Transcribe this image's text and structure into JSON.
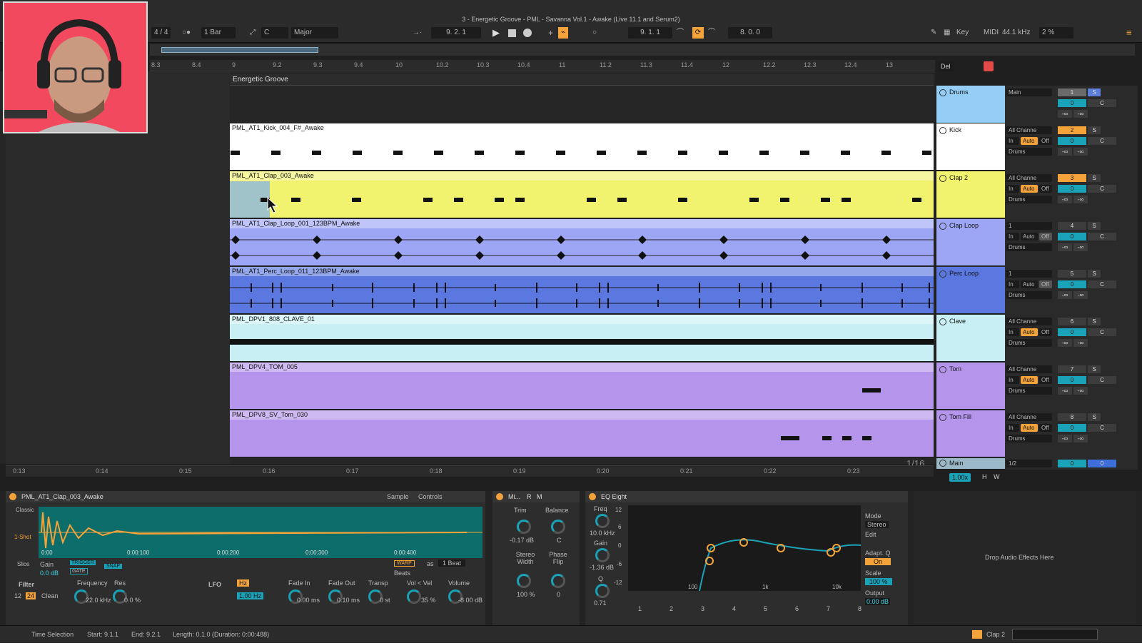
{
  "window": {
    "title": "3 - Energetic Groove - PML - Savanna Vol.1 - Awake (Live 11.1 and Serum2)"
  },
  "transport": {
    "signature": "4 / 4",
    "quantize": "1 Bar",
    "key": "C",
    "scale": "Major",
    "arr_position": "9.  2.  1",
    "loop_start": "9.  1.  1",
    "loop_length": "8.  0.  0",
    "key_label": "Key",
    "midi_label": "MIDI",
    "sample_rate": "44.1 kHz",
    "cpu": "2 %"
  },
  "ruler": {
    "marks": [
      "8.3",
      "8.4",
      "9",
      "9.2",
      "9.3",
      "9.4",
      "10",
      "10.2",
      "10.3",
      "10.4",
      "11",
      "11.2",
      "11.3",
      "11.4",
      "12",
      "12.2",
      "12.3",
      "12.4",
      "13"
    ],
    "locator": "Energetic Groove"
  },
  "tracks": [
    {
      "clip": "PML_AT1_Kick_004_F#_Awake",
      "name": "Kick",
      "input": "All Channe",
      "num": "2",
      "out": "Drums",
      "color": "#ffffff",
      "type": "hits"
    },
    {
      "clip": "PML_AT1_Clap_003_Awake",
      "name": "Clap 2",
      "input": "All Channe",
      "num": "3",
      "out": "Drums",
      "color": "#f1f36e",
      "type": "hits"
    },
    {
      "clip": "PML_AT1_Clap_Loop_001_123BPM_Awake",
      "name": "Clap Loop",
      "input": "1",
      "num": "4",
      "out": "Drums",
      "color": "#9da6f5",
      "type": "wave"
    },
    {
      "clip": "PML_AT1_Perc_Loop_011_123BPM_Awake",
      "name": "Perc Loop",
      "input": "1",
      "num": "5",
      "out": "Drums",
      "color": "#5b78e0",
      "type": "wave"
    },
    {
      "clip": "PML_DPV1_808_CLAVE_01",
      "name": "Clave",
      "input": "All Channe",
      "num": "6",
      "out": "Drums",
      "color": "#c8f0f4",
      "type": "dense"
    },
    {
      "clip": "PML_DPV4_TOM_005",
      "name": "Tom",
      "input": "All Channe",
      "num": "7",
      "out": "Drums",
      "color": "#b594ec",
      "type": "sparse"
    },
    {
      "clip": "PML_DPV8_SV_Tom_030",
      "name": "Tom Fill",
      "input": "All Channe",
      "num": "8",
      "out": "Drums",
      "color": "#b594ec",
      "type": "sparse2"
    }
  ],
  "group": {
    "name": "Drums",
    "route": "Main",
    "num": "1"
  },
  "main": {
    "name": "Main",
    "fraction": "1/2",
    "grid": "1/16",
    "zoom": "1.00x"
  },
  "mixer_labels": {
    "in": "In",
    "auto": "Auto",
    "off": "Off",
    "solo": "S",
    "center": "C",
    "inf": "-∞",
    "zero": "0",
    "del": "Del",
    "h": "H",
    "w": "W"
  },
  "time_axis": [
    "0:13",
    "0:14",
    "0:15",
    "0:16",
    "0:17",
    "0:18",
    "0:19",
    "0:20",
    "0:21",
    "0:22",
    "0:23"
  ],
  "simpler": {
    "name": "PML_AT1_Clap_003_Awake",
    "tab_sample": "Sample",
    "tab_controls": "Controls",
    "modes": [
      "Classic",
      "1-Shot",
      "Slice"
    ],
    "gain_label": "Gain",
    "gain": "0.0 dB",
    "trigger": "TRIGGER",
    "gate": "GATE",
    "snap": "SNAP",
    "warp": "WARP",
    "as": "as",
    "beat": "1 Beat",
    "beats": "Beats",
    "times": [
      "0:00",
      "0:00:100",
      "0:00:200",
      "0:00:300",
      "0:00:400"
    ],
    "filter": "Filter",
    "freq_label": "Frequency",
    "res_label": "Res",
    "freq": "22.0 kHz",
    "res": "0.0 %",
    "f12": "12",
    "f24": "24",
    "clean": "Clean",
    "lfo": "LFO",
    "hz": "Hz",
    "lfo_rate": "1.00 Hz",
    "fade_in_label": "Fade In",
    "fade_in": "0.00 ms",
    "fade_out_label": "Fade Out",
    "fade_out": "0.10 ms",
    "transp_label": "Transp",
    "transp": "0 st",
    "vel_label": "Vol < Vel",
    "vel": "35 %",
    "vol_label": "Volume",
    "vol": "-8.00 dB"
  },
  "utility": {
    "name": "Mi...",
    "r": "R",
    "m": "M",
    "trim": "Trim",
    "trim_val": "-0.17 dB",
    "balance": "Balance",
    "balance_val": "C",
    "width": "Stereo Width",
    "width_val": "100 %",
    "phase": "Phase Flip",
    "phase_val": "0"
  },
  "eq": {
    "name": "EQ Eight",
    "freq_label": "Freq",
    "freq": "10.0 kHz",
    "gain_label": "Gain",
    "gain": "-1.36 dB",
    "q_label": "Q",
    "q": "0.71",
    "db": [
      "12",
      "6",
      "0",
      "-6",
      "-12"
    ],
    "hz": [
      "100",
      "1k",
      "10k"
    ],
    "mode_label": "Mode",
    "mode": "Stereo",
    "edit": "Edit",
    "adapt": "Adapt. Q",
    "on": "On",
    "scale_label": "Scale",
    "scale": "100 %",
    "output_label": "Output",
    "output": "0.00 dB",
    "bands": [
      "1",
      "2",
      "3",
      "4",
      "5",
      "6",
      "7",
      "8"
    ]
  },
  "drop_hint": "Drop Audio Effects Here",
  "status": {
    "mode": "Time Selection",
    "start": "Start: 9.1.1",
    "end": "End: 9.2.1",
    "length": "Length: 0.1.0 (Duration: 0:00:488)",
    "track": "Clap 2"
  }
}
